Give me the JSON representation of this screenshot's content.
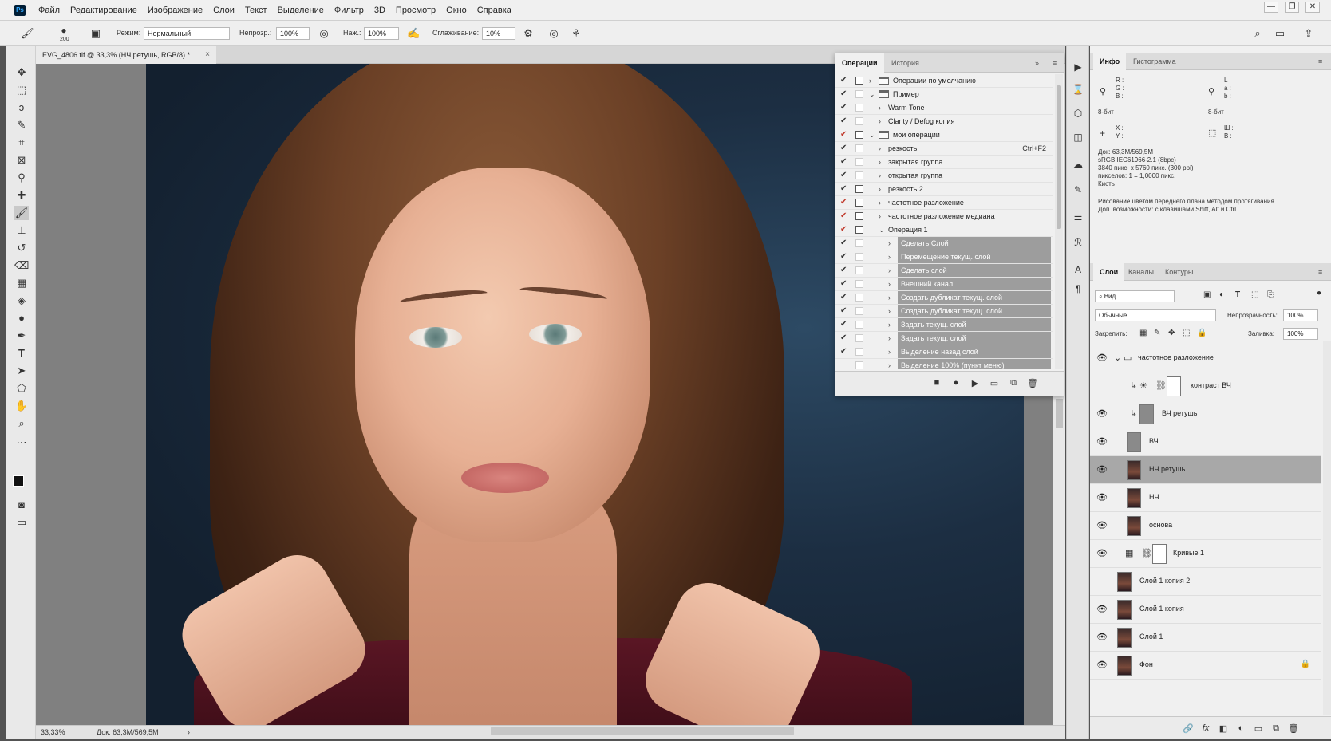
{
  "app": {
    "logo": "Ps"
  },
  "menu": [
    "Файл",
    "Редактирование",
    "Изображение",
    "Слои",
    "Текст",
    "Выделение",
    "Фильтр",
    "3D",
    "Просмотр",
    "Окно",
    "Справка"
  ],
  "window_controls": {
    "minimize": "—",
    "restore": "❐",
    "close": "✕"
  },
  "options": {
    "brush_size": "200",
    "mode_label": "Режим:",
    "mode_value": "Нормальный",
    "opacity_label": "Непрозр.:",
    "opacity_value": "100%",
    "pressure_label": "Наж.:",
    "pressure_value": "100%",
    "smoothing_label": "Сглаживание:",
    "smoothing_value": "10%"
  },
  "document": {
    "tab_title": "EVG_4806.tif @ 33,3% (НЧ ретушь, RGB/8) *",
    "close": "×",
    "zoom": "33,33%",
    "doc_size": "Док: 63,3M/569,5M",
    "status_arrow": "›"
  },
  "actions_panel": {
    "tabs": [
      "Операции",
      "История"
    ],
    "collapse": "»",
    "menu": "≡",
    "rows": [
      {
        "label": "Операции по умолчанию",
        "check": true,
        "red": false,
        "dialog": true,
        "level": 0,
        "expanded": false,
        "folder": true,
        "shortcut": "",
        "selected": false
      },
      {
        "label": "Пример",
        "check": true,
        "red": false,
        "dialog": false,
        "level": 0,
        "expanded": true,
        "folder": true,
        "shortcut": "",
        "selected": false
      },
      {
        "label": "Warm Tone",
        "check": true,
        "red": false,
        "dialog": false,
        "level": 1,
        "expanded": false,
        "folder": false,
        "shortcut": "",
        "selected": false
      },
      {
        "label": "Clarity / Defog копия",
        "check": true,
        "red": false,
        "dialog": false,
        "level": 1,
        "expanded": false,
        "folder": false,
        "shortcut": "",
        "selected": false
      },
      {
        "label": "мои операции",
        "check": true,
        "red": true,
        "dialog": true,
        "level": 0,
        "expanded": true,
        "folder": true,
        "shortcut": "",
        "selected": false
      },
      {
        "label": "резкость",
        "check": true,
        "red": false,
        "dialog": false,
        "level": 1,
        "expanded": false,
        "folder": false,
        "shortcut": "Ctrl+F2",
        "selected": false
      },
      {
        "label": "закрытая группа",
        "check": true,
        "red": false,
        "dialog": false,
        "level": 1,
        "expanded": false,
        "folder": false,
        "shortcut": "",
        "selected": false
      },
      {
        "label": "открытая группа",
        "check": true,
        "red": false,
        "dialog": false,
        "level": 1,
        "expanded": false,
        "folder": false,
        "shortcut": "",
        "selected": false
      },
      {
        "label": "резкость 2",
        "check": true,
        "red": false,
        "dialog": true,
        "level": 1,
        "expanded": false,
        "folder": false,
        "shortcut": "",
        "selected": false
      },
      {
        "label": "частотное разложение",
        "check": true,
        "red": true,
        "dialog": true,
        "level": 1,
        "expanded": false,
        "folder": false,
        "shortcut": "",
        "selected": false
      },
      {
        "label": "частотное разложение медиана",
        "check": true,
        "red": true,
        "dialog": true,
        "level": 1,
        "expanded": false,
        "folder": false,
        "shortcut": "",
        "selected": false
      },
      {
        "label": "Операция 1",
        "check": true,
        "red": true,
        "dialog": true,
        "level": 1,
        "expanded": true,
        "folder": false,
        "shortcut": "",
        "selected": false
      },
      {
        "label": "Сделать Слой",
        "check": true,
        "red": false,
        "dialog": false,
        "level": 2,
        "expanded": false,
        "folder": false,
        "shortcut": "",
        "selected": true
      },
      {
        "label": "Перемещение текущ. слой",
        "check": true,
        "red": false,
        "dialog": false,
        "level": 2,
        "expanded": false,
        "folder": false,
        "shortcut": "",
        "selected": true
      },
      {
        "label": "Сделать слой",
        "check": true,
        "red": false,
        "dialog": false,
        "level": 2,
        "expanded": false,
        "folder": false,
        "shortcut": "",
        "selected": true
      },
      {
        "label": "Внешний канал",
        "check": true,
        "red": false,
        "dialog": false,
        "level": 2,
        "expanded": false,
        "folder": false,
        "shortcut": "",
        "selected": true
      },
      {
        "label": "Создать дубликат текущ. слой",
        "check": true,
        "red": false,
        "dialog": false,
        "level": 2,
        "expanded": false,
        "folder": false,
        "shortcut": "",
        "selected": true
      },
      {
        "label": "Создать дубликат текущ. слой",
        "check": true,
        "red": false,
        "dialog": false,
        "level": 2,
        "expanded": false,
        "folder": false,
        "shortcut": "",
        "selected": true
      },
      {
        "label": "Задать текущ. слой",
        "check": true,
        "red": false,
        "dialog": false,
        "level": 2,
        "expanded": false,
        "folder": false,
        "shortcut": "",
        "selected": true
      },
      {
        "label": "Задать текущ. слой",
        "check": true,
        "red": false,
        "dialog": false,
        "level": 2,
        "expanded": false,
        "folder": false,
        "shortcut": "",
        "selected": true
      },
      {
        "label": "Выделение назад слой",
        "check": true,
        "red": false,
        "dialog": false,
        "level": 2,
        "expanded": false,
        "folder": false,
        "shortcut": "",
        "selected": true
      },
      {
        "label": "Выделение 100% (пункт меню)",
        "check": false,
        "red": false,
        "dialog": false,
        "level": 2,
        "expanded": false,
        "folder": false,
        "shortcut": "",
        "selected": true
      }
    ],
    "bottom_buttons": [
      "■",
      "●",
      "▶",
      "▭",
      "⧉",
      "🗑"
    ]
  },
  "info_panel": {
    "tabs": [
      "Инфо",
      "Гистограмма"
    ],
    "rgb": [
      "R :",
      "G :",
      "B :"
    ],
    "lab": [
      "L :",
      "a :",
      "b :"
    ],
    "bits_left": "8-бит",
    "bits_right": "8-бит",
    "xy": [
      "X :",
      "Y :"
    ],
    "wh": [
      "Ш :",
      "В :"
    ],
    "doc_info": [
      "Док: 63,3M/569,5M",
      "sRGB IEC61966-2.1 (8bpc)",
      "3840 пикс. x 5760 пикс. (300 ppi)",
      "пикселов: 1 = 1,0000 пикс.",
      "Кисть"
    ],
    "hint": [
      "Рисование цветом переднего плана методом протягивания.",
      "Доп. возможности: с клавишами Shift, Alt и Ctrl."
    ]
  },
  "layers_panel": {
    "tabs": [
      "Слои",
      "Каналы",
      "Контуры"
    ],
    "filter": "Вид",
    "blend_mode": "Обычные",
    "opacity_label": "Непрозрачность:",
    "opacity_value": "100%",
    "lock_label": "Закрепить:",
    "fill_label": "Заливка:",
    "fill_value": "100%",
    "layers": [
      {
        "name": "частотное разложение",
        "visible": true,
        "kind": "group",
        "selected": false,
        "locked": false,
        "indent": 0
      },
      {
        "name": "контраст ВЧ",
        "visible": false,
        "kind": "adjust",
        "selected": false,
        "locked": false,
        "indent": 1
      },
      {
        "name": "ВЧ ретушь",
        "visible": true,
        "kind": "gray-clip",
        "selected": false,
        "locked": false,
        "indent": 1
      },
      {
        "name": "ВЧ",
        "visible": true,
        "kind": "gray",
        "selected": false,
        "locked": false,
        "indent": 1
      },
      {
        "name": "НЧ ретушь",
        "visible": true,
        "kind": "photo",
        "selected": true,
        "locked": false,
        "indent": 1
      },
      {
        "name": "НЧ",
        "visible": true,
        "kind": "photo",
        "selected": false,
        "locked": false,
        "indent": 1
      },
      {
        "name": "основа",
        "visible": true,
        "kind": "photo",
        "selected": false,
        "locked": false,
        "indent": 1
      },
      {
        "name": "Кривые 1",
        "visible": true,
        "kind": "curves",
        "selected": false,
        "locked": false,
        "indent": 1
      },
      {
        "name": "Слой 1 копия 2",
        "visible": false,
        "kind": "photo",
        "selected": false,
        "locked": false,
        "indent": 0
      },
      {
        "name": "Слой 1 копия",
        "visible": true,
        "kind": "photo",
        "selected": false,
        "locked": false,
        "indent": 0
      },
      {
        "name": "Слой 1",
        "visible": true,
        "kind": "photo",
        "selected": false,
        "locked": false,
        "indent": 0
      },
      {
        "name": "Фон",
        "visible": true,
        "kind": "photo",
        "selected": false,
        "locked": true,
        "indent": 0
      }
    ],
    "bottom_buttons": [
      "🔗",
      "fx",
      "◧",
      "◐",
      "▭",
      "⧉",
      "🗑"
    ]
  }
}
